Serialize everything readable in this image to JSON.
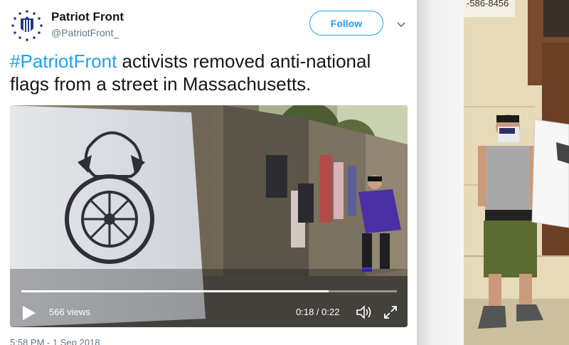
{
  "tweet": {
    "author": {
      "display_name": "Patriot Front",
      "handle": "@PatriotFront_",
      "avatar_icon": "patriot-front-logo-icon"
    },
    "follow_label": "Follow",
    "caret_icon": "chevron-down-icon",
    "text": {
      "hashtag": "#PatriotFront",
      "body": " activists removed anti-national flags from a street in Massachusetts."
    },
    "video": {
      "views": "566 views",
      "time": "0:18 / 0:22",
      "progress": 0.818,
      "play_icon": "play-icon",
      "volume_icon": "volume-icon",
      "fullscreen_icon": "fullscreen-icon"
    },
    "timestamp": "5:58 PM - 1 Sep 2018"
  },
  "background_photo": {
    "sign_text": "-586-8456"
  },
  "colors": {
    "accent": "#1da1f2",
    "text": "#14171a",
    "muted": "#657786"
  }
}
